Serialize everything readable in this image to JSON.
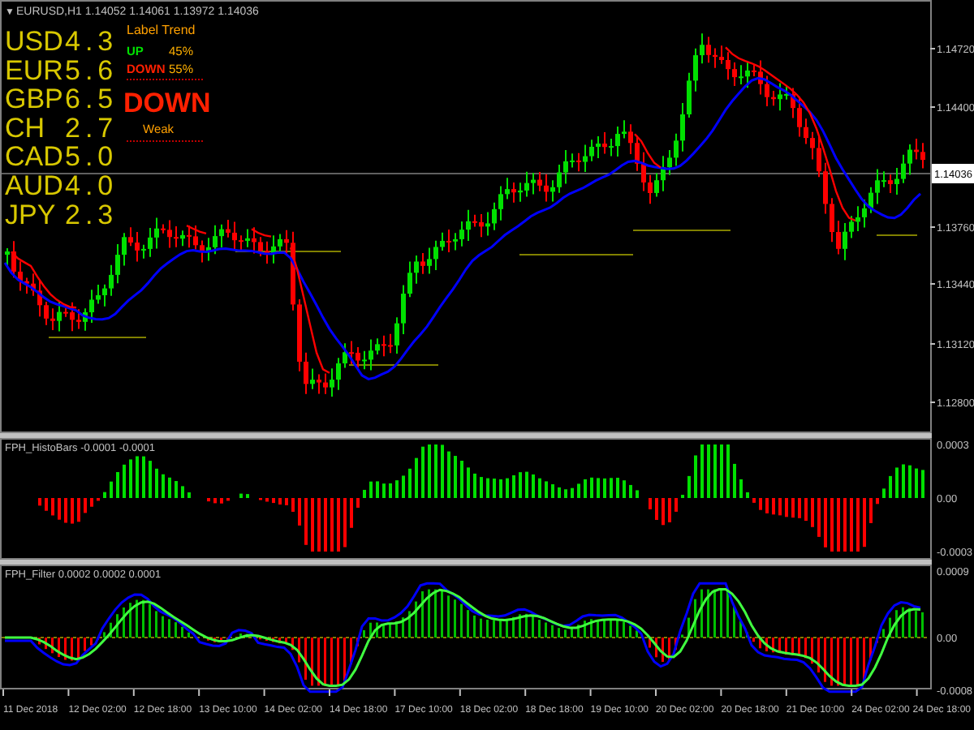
{
  "header": {
    "menu_glyph": "▼",
    "symbol": "EURUSD,H1",
    "prices": [
      "1.14052",
      "1.14061",
      "1.13972",
      "1.14036"
    ]
  },
  "strength_table": [
    {
      "currency": "USD",
      "value": "4.3"
    },
    {
      "currency": "EUR",
      "value": "5.6"
    },
    {
      "currency": "GBP",
      "value": "6.5"
    },
    {
      "currency": "CH",
      "value": "2.7"
    },
    {
      "currency": "CAD",
      "value": "5.0"
    },
    {
      "currency": "AUD",
      "value": "4.0"
    },
    {
      "currency": "JPY",
      "value": "2.3"
    }
  ],
  "trend_panel": {
    "title": "Label Trend",
    "rows": [
      {
        "label": "UP",
        "value": "45%",
        "kind": "up"
      },
      {
        "label": "DOWN",
        "value": "55%",
        "kind": "down"
      }
    ],
    "signal": {
      "text": "DOWN",
      "kind": "down"
    },
    "strength": "Weak"
  },
  "price_axis": {
    "labels": [
      "1.14720",
      "1.14400",
      "1.13760",
      "1.13440",
      "1.13120",
      "1.12800"
    ],
    "current_price": "1.14036"
  },
  "histobars_pane": {
    "title": "FPH_HistoBars -0.0001 -0.0001",
    "axis_labels": [
      "0.0003",
      "0.00",
      "-0.0003"
    ]
  },
  "filter_pane": {
    "title": "FPH_Filter 0.0002 0.0002 0.0001",
    "axis_labels": [
      "0.0009",
      "0.00",
      "-0.0008"
    ]
  },
  "time_axis": {
    "labels": [
      "11 Dec 2018",
      "12 Dec 02:00",
      "12 Dec 18:00",
      "13 Dec 10:00",
      "14 Dec 02:00",
      "14 Dec 18:00",
      "17 Dec 10:00",
      "18 Dec 02:00",
      "18 Dec 18:00",
      "19 Dec 10:00",
      "20 Dec 02:00",
      "20 Dec 18:00",
      "21 Dec 10:00",
      "24 Dec 02:00",
      "24 Dec 18:00"
    ]
  }
}
